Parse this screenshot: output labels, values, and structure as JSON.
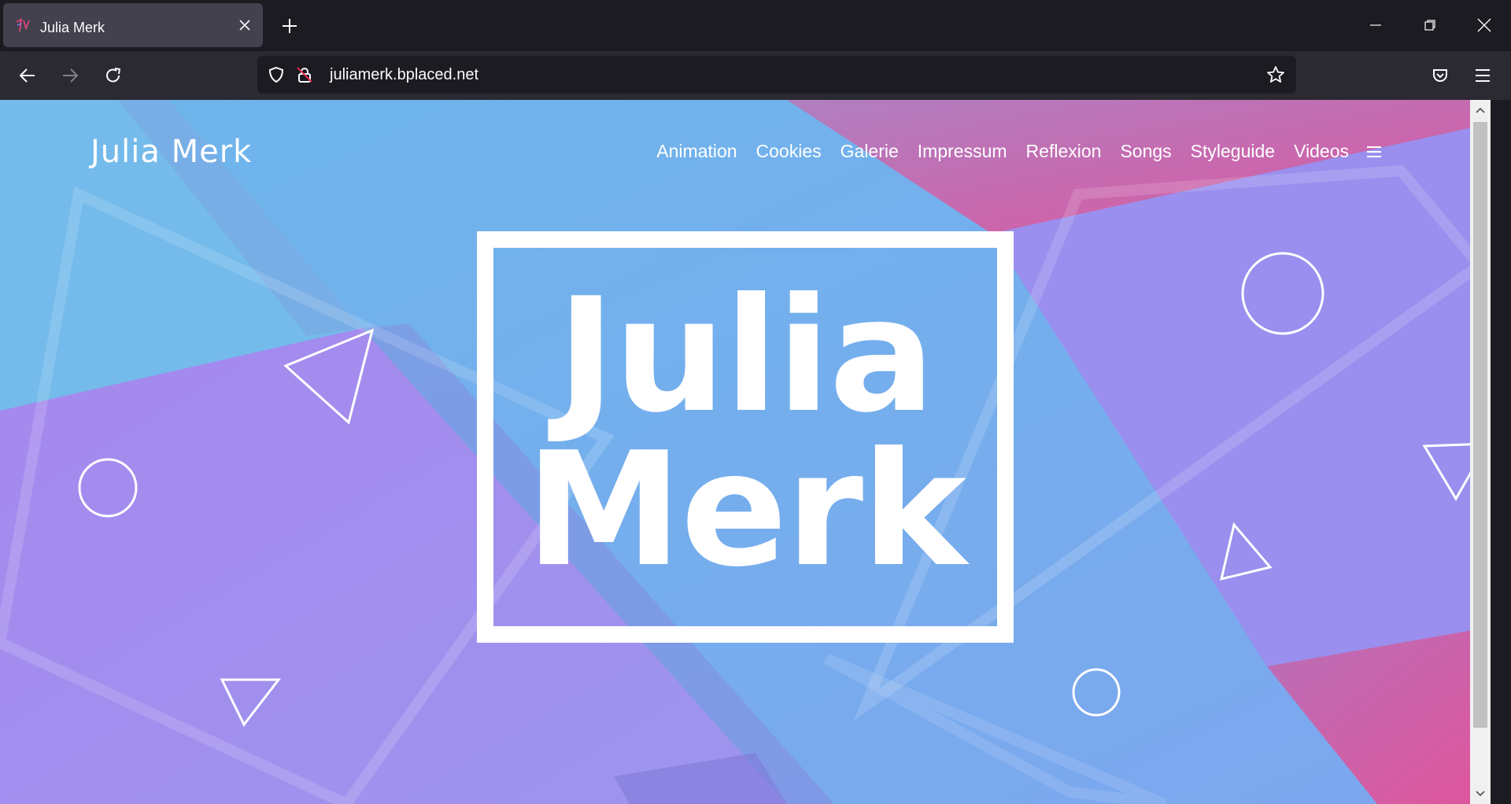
{
  "browser": {
    "tab_title": "Julia Merk",
    "url": "juliamerk.bplaced.net"
  },
  "site": {
    "title": "Julia Merk",
    "nav": [
      {
        "label": "Animation"
      },
      {
        "label": "Cookies"
      },
      {
        "label": "Galerie"
      },
      {
        "label": "Impressum"
      },
      {
        "label": "Reflexion"
      },
      {
        "label": "Songs"
      },
      {
        "label": "Styleguide"
      },
      {
        "label": "Videos"
      }
    ],
    "hero_line1": "Julia",
    "hero_line2": "Merk"
  },
  "colors": {
    "chrome_dark": "#1c1b22",
    "chrome_toolbar": "#2b2a33",
    "blue": "#6aaeec",
    "purple": "#9f8ff0",
    "pink": "#d85aa5"
  },
  "icons": [
    "tab-favicon-icon",
    "close-icon",
    "plus-icon",
    "minimize-icon",
    "restore-icon",
    "window-close-icon",
    "back-arrow-icon",
    "forward-arrow-icon",
    "reload-icon",
    "shield-icon",
    "insecure-lock-icon",
    "star-icon",
    "pocket-icon",
    "app-menu-icon",
    "hamburger-icon"
  ]
}
